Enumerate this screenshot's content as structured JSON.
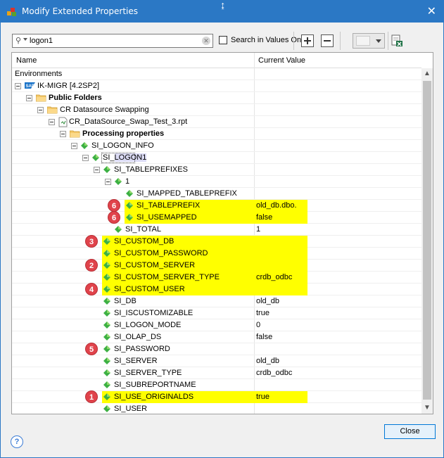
{
  "window": {
    "title": "Modify Extended Properties",
    "close_symbol": "✕",
    "cursor_symbol": "↨"
  },
  "toolbar": {
    "search_value": "logon1",
    "clear_symbol": "✕",
    "search_values_only_label": "Search in Values Only",
    "search_values_only_checked": false
  },
  "grid": {
    "columns": [
      "Name",
      "Current Value"
    ],
    "rows": [
      {
        "name": "Environments",
        "value": "",
        "level": 0,
        "icon": "none",
        "expander": false,
        "bold": false,
        "highlight": false,
        "badge": ""
      },
      {
        "name": "IK-MIGR [4.2SP2]",
        "value": "",
        "level": 1,
        "icon": "sap-icon",
        "expander": true,
        "bold": false,
        "highlight": false,
        "badge": ""
      },
      {
        "name": "Public Folders",
        "value": "",
        "level": 2,
        "icon": "folder-icon",
        "expander": true,
        "bold": true,
        "highlight": false,
        "badge": ""
      },
      {
        "name": "CR Datasource Swapping",
        "value": "",
        "level": 3,
        "icon": "folder-icon",
        "expander": true,
        "bold": false,
        "highlight": false,
        "badge": ""
      },
      {
        "name": "CR_DataSource_Swap_Test_3.rpt",
        "value": "",
        "level": 4,
        "icon": "report-icon",
        "expander": true,
        "bold": false,
        "highlight": false,
        "badge": ""
      },
      {
        "name": "Processing properties",
        "value": "",
        "level": 5,
        "icon": "folder-icon",
        "expander": true,
        "bold": true,
        "highlight": false,
        "badge": ""
      },
      {
        "name": "SI_LOGON_INFO",
        "value": "",
        "level": 6,
        "icon": "property-icon",
        "expander": true,
        "bold": false,
        "highlight": false,
        "badge": ""
      },
      {
        "name": "SI_",
        "name_match": "LOGON1",
        "value": "",
        "level": 7,
        "icon": "property-icon",
        "expander": true,
        "bold": false,
        "highlight": false,
        "badge": "",
        "focused": true
      },
      {
        "name": "SI_TABLEPREFIXES",
        "value": "",
        "level": 8,
        "icon": "property-icon",
        "expander": true,
        "bold": false,
        "highlight": false,
        "badge": ""
      },
      {
        "name": "1",
        "value": "",
        "level": 9,
        "icon": "property-icon",
        "expander": true,
        "bold": false,
        "highlight": false,
        "badge": ""
      },
      {
        "name": "SI_MAPPED_TABLEPREFIX",
        "value": "",
        "level": 10,
        "icon": "property-icon",
        "expander": false,
        "bold": false,
        "highlight": false,
        "badge": ""
      },
      {
        "name": "SI_TABLEPREFIX",
        "value": "old_db.dbo.",
        "level": 10,
        "icon": "property-icon",
        "expander": false,
        "bold": false,
        "highlight": true,
        "badge": "6"
      },
      {
        "name": "SI_USEMAPPED",
        "value": "false",
        "level": 10,
        "icon": "property-icon",
        "expander": false,
        "bold": false,
        "highlight": true,
        "badge": "6"
      },
      {
        "name": "SI_TOTAL",
        "value": "1",
        "level": 9,
        "icon": "property-icon",
        "expander": false,
        "bold": false,
        "highlight": false,
        "badge": ""
      },
      {
        "name": "SI_CUSTOM_DB",
        "value": "",
        "level": 8,
        "icon": "property-icon",
        "expander": false,
        "bold": false,
        "highlight": true,
        "badge": "3"
      },
      {
        "name": "SI_CUSTOM_PASSWORD",
        "value": "",
        "level": 8,
        "icon": "property-icon",
        "expander": false,
        "bold": false,
        "highlight": true,
        "badge": ""
      },
      {
        "name": "SI_CUSTOM_SERVER",
        "value": "",
        "level": 8,
        "icon": "property-icon",
        "expander": false,
        "bold": false,
        "highlight": true,
        "badge": "2"
      },
      {
        "name": "SI_CUSTOM_SERVER_TYPE",
        "value": "crdb_odbc",
        "level": 8,
        "icon": "property-icon",
        "expander": false,
        "bold": false,
        "highlight": true,
        "badge": ""
      },
      {
        "name": "SI_CUSTOM_USER",
        "value": "",
        "level": 8,
        "icon": "property-icon",
        "expander": false,
        "bold": false,
        "highlight": true,
        "badge": "4"
      },
      {
        "name": "SI_DB",
        "value": "old_db",
        "level": 8,
        "icon": "property-icon",
        "expander": false,
        "bold": false,
        "highlight": false,
        "badge": ""
      },
      {
        "name": "SI_ISCUSTOMIZABLE",
        "value": "true",
        "level": 8,
        "icon": "property-icon",
        "expander": false,
        "bold": false,
        "highlight": false,
        "badge": ""
      },
      {
        "name": "SI_LOGON_MODE",
        "value": "0",
        "level": 8,
        "icon": "property-icon",
        "expander": false,
        "bold": false,
        "highlight": false,
        "badge": ""
      },
      {
        "name": "SI_OLAP_DS",
        "value": "false",
        "level": 8,
        "icon": "property-icon",
        "expander": false,
        "bold": false,
        "highlight": false,
        "badge": ""
      },
      {
        "name": "SI_PASSWORD",
        "value": "",
        "level": 8,
        "icon": "property-icon",
        "expander": false,
        "bold": false,
        "highlight": false,
        "badge": "5"
      },
      {
        "name": "SI_SERVER",
        "value": "old_db",
        "level": 8,
        "icon": "property-icon",
        "expander": false,
        "bold": false,
        "highlight": false,
        "badge": ""
      },
      {
        "name": "SI_SERVER_TYPE",
        "value": "crdb_odbc",
        "level": 8,
        "icon": "property-icon",
        "expander": false,
        "bold": false,
        "highlight": false,
        "badge": ""
      },
      {
        "name": "SI_SUBREPORTNAME",
        "value": "",
        "level": 8,
        "icon": "property-icon",
        "expander": false,
        "bold": false,
        "highlight": false,
        "badge": ""
      },
      {
        "name": "SI_USE_ORIGINALDS",
        "value": "true",
        "level": 8,
        "icon": "property-icon",
        "expander": false,
        "bold": false,
        "highlight": true,
        "badge": "1"
      },
      {
        "name": "SI_USER",
        "value": "",
        "level": 8,
        "icon": "property-icon",
        "expander": false,
        "bold": false,
        "highlight": false,
        "badge": ""
      }
    ]
  },
  "footer": {
    "close_label": "Close",
    "help_symbol": "?"
  },
  "colors": {
    "titlebar": "#2b78c5",
    "highlight": "#ffff00",
    "badge": "#e0434b",
    "property_icon": "#3cb043"
  }
}
